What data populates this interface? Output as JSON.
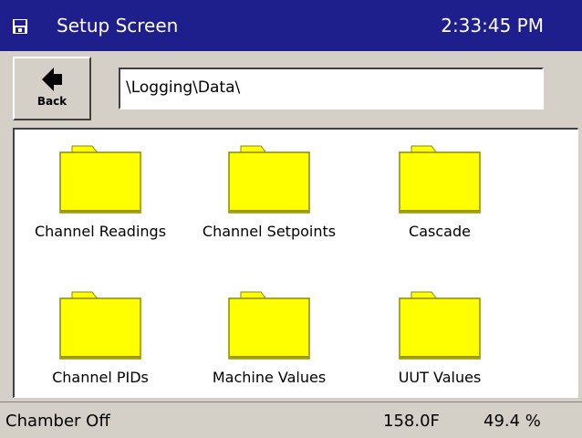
{
  "titlebar": {
    "icon": "floppy-disk-icon",
    "title": "Setup Screen",
    "time": "2:33:45 PM",
    "background": "#1e1e8c"
  },
  "toolbar": {
    "back_label": "Back",
    "back_icon": "left-arrow-icon",
    "path": "\\Logging\\Data\\"
  },
  "folders": [
    {
      "label": "Channel Readings",
      "icon": "folder-icon"
    },
    {
      "label": "Channel Setpoints",
      "icon": "folder-icon"
    },
    {
      "label": "Cascade",
      "icon": "folder-icon"
    },
    {
      "label": "Channel PIDs",
      "icon": "folder-icon"
    },
    {
      "label": "Machine Values",
      "icon": "folder-icon"
    },
    {
      "label": "UUT Values",
      "icon": "folder-icon"
    }
  ],
  "folder_color": "#ffff00",
  "status": {
    "chamber": "Chamber Off",
    "temperature": "158.0F",
    "humidity": "49.4 %"
  }
}
